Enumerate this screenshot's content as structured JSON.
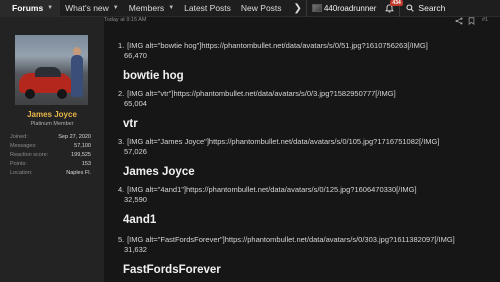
{
  "nav": {
    "items": [
      {
        "label": "Forums",
        "name": "nav-forums",
        "dropdown": true,
        "active": true
      },
      {
        "label": "What's new",
        "name": "nav-whats-new",
        "dropdown": true
      },
      {
        "label": "Members",
        "name": "nav-members",
        "dropdown": true
      },
      {
        "label": "Latest Posts",
        "name": "nav-latest-posts",
        "dropdown": false
      },
      {
        "label": "New Posts",
        "name": "nav-new-posts",
        "dropdown": false
      }
    ],
    "username": "440roadrunner",
    "alerts_badge": "434",
    "search_label": "Search"
  },
  "sidebar": {
    "name": "James Joyce",
    "title": "Platinum Member",
    "stats": [
      {
        "label": "Joined:",
        "value": "Sep 27, 2020"
      },
      {
        "label": "Messages:",
        "value": "57,100"
      },
      {
        "label": "Reaction score:",
        "value": "199,525"
      },
      {
        "label": "Points:",
        "value": "153"
      },
      {
        "label": "Location:",
        "value": "Naples Fl."
      }
    ]
  },
  "post": {
    "time": "Today at 9:15 AM",
    "post_number": "#1",
    "entries": [
      {
        "num": "1.",
        "img": "[IMG alt=\"bowtie hog\"]https://phantombullet.net/data/avatars/s/0/51.jpg?1610756263[/IMG]",
        "id": "66,470",
        "name": "bowtie hog"
      },
      {
        "num": "2.",
        "img": "[IMG alt=\"vtr\"]https://phantombullet.net/data/avatars/s/0/3.jpg?1582950777[/IMG]",
        "id": "65,004",
        "name": "vtr"
      },
      {
        "num": "3.",
        "img": "[IMG alt=\"James Joyce\"]https://phantombullet.net/data/avatars/s/0/105.jpg?1716751082[/IMG]",
        "id": "57,026",
        "name": "James Joyce"
      },
      {
        "num": "4.",
        "img": "[IMG alt=\"4and1\"]https://phantombullet.net/data/avatars/s/0/125.jpg?1606470330[/IMG]",
        "id": "32,590",
        "name": "4and1"
      },
      {
        "num": "5.",
        "img": "[IMG alt=\"FastFordsForever\"]https://phantombullet.net/data/avatars/s/0/303.jpg?1611382097[/IMG]",
        "id": "31,632",
        "name": "FastFordsForever"
      }
    ]
  },
  "colors": {
    "background": "#161616",
    "sidebar": "#232323",
    "member_name": "#e8b84a",
    "badge": "#c0392b"
  },
  "icons": [
    "chevron-down-icon",
    "nav-right-arrow-icon",
    "alerts-bell-icon",
    "search-icon",
    "share-icon",
    "bookmark-icon"
  ]
}
